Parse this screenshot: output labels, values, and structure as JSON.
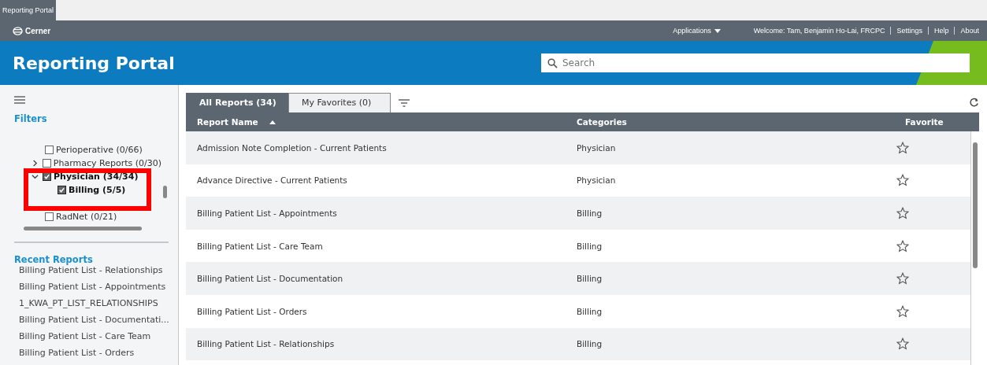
{
  "browser_tab": {
    "title": "Reporting Portal"
  },
  "top_bar": {
    "logo": "Cerner",
    "menu": "Applications",
    "welcome": "Welcome: Tam, Benjamin Ho-Lai, FRCPC",
    "links": [
      "Settings",
      "Help",
      "About"
    ]
  },
  "banner": {
    "title": "Reporting Portal",
    "search": {
      "placeholder": "Search"
    }
  },
  "sidebar": {
    "filters_title": "Filters",
    "filters": [
      {
        "label": "Perioperative (0/66)",
        "checked": false
      },
      {
        "label": "Pharmacy Reports (0/30)",
        "checked": false,
        "expanded": false
      },
      {
        "label": "Physician (34/34)",
        "checked": true,
        "expanded": true,
        "children": [
          {
            "label": "Billing (5/5)",
            "checked": true
          }
        ]
      },
      {
        "label": "RadNet (0/21)",
        "checked": false
      }
    ],
    "recent_title": "Recent Reports",
    "recent": [
      "Billing Patient List - Relationships",
      "Billing Patient List - Appointments",
      "1_KWA_PT_LIST_RELATIONSHIPS",
      "Billing Patient List - Documentati...",
      "Billing Patient List - Care Team",
      "Billing Patient List - Orders"
    ]
  },
  "tabs": [
    {
      "label": "All Reports (34)",
      "selected": true
    },
    {
      "label": "My Favorites (0)",
      "selected": false
    }
  ],
  "table": {
    "columns": [
      "Report Name",
      "Categories",
      "Favorite"
    ],
    "sort_ascending": true,
    "rows": [
      {
        "name": "Admission Note Completion - Current Patients",
        "category": "Physician",
        "favorite": false
      },
      {
        "name": "Advance Directive - Current Patients",
        "category": "Physician",
        "favorite": false
      },
      {
        "name": "Billing Patient List - Appointments",
        "category": "Billing",
        "favorite": false
      },
      {
        "name": "Billing Patient List - Care Team",
        "category": "Billing",
        "favorite": false
      },
      {
        "name": "Billing Patient List - Documentation",
        "category": "Billing",
        "favorite": false
      },
      {
        "name": "Billing Patient List - Orders",
        "category": "Billing",
        "favorite": false
      },
      {
        "name": "Billing Patient List - Relationships",
        "category": "Billing",
        "favorite": false
      }
    ]
  }
}
